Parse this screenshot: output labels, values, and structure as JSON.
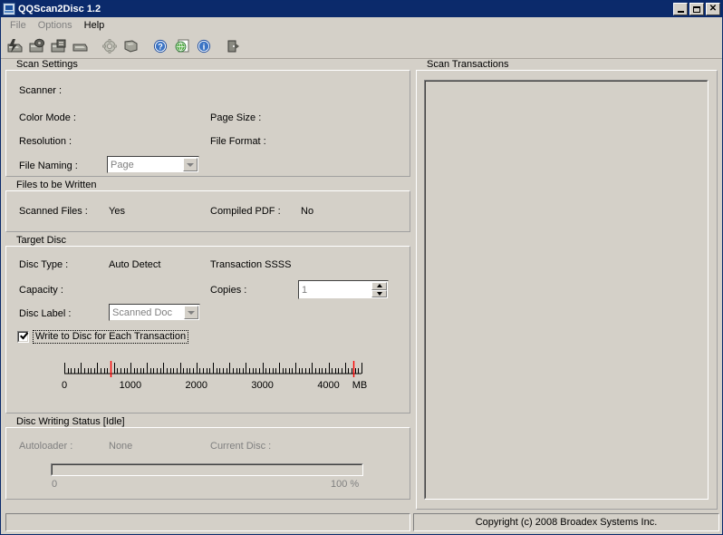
{
  "window": {
    "title": "QQScan2Disc 1.2",
    "icon": "scanner-icon",
    "buttons": {
      "minimize": "minimize-button",
      "maximize": "maximize-button",
      "close": "close-button"
    }
  },
  "menubar": {
    "items": [
      {
        "label": "File",
        "enabled": false
      },
      {
        "label": "Options",
        "enabled": false
      },
      {
        "label": "Help",
        "enabled": true
      }
    ]
  },
  "toolbar": {
    "buttons": [
      {
        "name": "scan-now-icon",
        "tooltip": "Scan"
      },
      {
        "name": "scan-to-disc-icon",
        "tooltip": "Scan to Disc"
      },
      {
        "name": "scan-to-file-icon",
        "tooltip": "Scan to File"
      },
      {
        "name": "disc-icon",
        "tooltip": "Disc"
      },
      {
        "name": "settings-gear-icon",
        "tooltip": "Settings"
      },
      {
        "name": "disc-write-icon",
        "tooltip": "Write Disc"
      },
      {
        "name": "help-question-icon",
        "tooltip": "Help"
      },
      {
        "name": "web-help-globe-icon",
        "tooltip": "Web Help"
      },
      {
        "name": "about-info-icon",
        "tooltip": "About"
      },
      {
        "name": "exit-door-icon",
        "tooltip": "Exit"
      }
    ]
  },
  "scan_settings": {
    "title": "Scan Settings",
    "scanner_label": "Scanner :",
    "scanner_value": "",
    "color_mode_label": "Color Mode :",
    "color_mode_value": "",
    "page_size_label": "Page Size :",
    "page_size_value": "",
    "resolution_label": "Resolution :",
    "resolution_value": "",
    "file_format_label": "File Format :",
    "file_format_value": "",
    "file_naming_label": "File Naming :",
    "file_naming_value": "Page"
  },
  "files_to_be_written": {
    "title": "Files to be Written",
    "scanned_files_label": "Scanned Files :",
    "scanned_files_value": "Yes",
    "compiled_pdf_label": "Compiled PDF :",
    "compiled_pdf_value": "No"
  },
  "target_disc": {
    "title": "Target Disc",
    "disc_type_label": "Disc Type :",
    "disc_type_value": "Auto Detect",
    "transaction_label": "Transaction SSSS",
    "capacity_label": "Capacity :",
    "capacity_value": "",
    "copies_label": "Copies :",
    "copies_value": "1",
    "disc_label_label": "Disc Label :",
    "disc_label_value": "Scanned Doc",
    "write_each_transaction_label": "Write to Disc for Each Transaction",
    "write_each_transaction_checked": true
  },
  "capacity_ruler": {
    "min": 0,
    "max": 4500,
    "tick_major_step": 250,
    "tick_minor_step": 50,
    "tick_labels": [
      {
        "value": 0,
        "text": "0"
      },
      {
        "value": 1000,
        "text": "1000"
      },
      {
        "value": 2000,
        "text": "2000"
      },
      {
        "value": 3000,
        "text": "3000"
      },
      {
        "value": 4000,
        "text": "4000"
      }
    ],
    "unit_label": "MB",
    "markers": [
      {
        "value": 700,
        "color": "#ff0000",
        "name": "cd-capacity-marker"
      },
      {
        "value": 4380,
        "color": "#ff0000",
        "name": "dvd-capacity-marker"
      }
    ]
  },
  "disc_writing_status": {
    "title": "Disc Writing Status  [Idle]",
    "state": "Idle",
    "autoloader_label": "Autoloader :",
    "autoloader_value": "None",
    "current_disc_label": "Current Disc :",
    "current_disc_value": "",
    "progress_percent": 0,
    "progress_min_label": "0",
    "progress_max_label": "100 %"
  },
  "scan_transactions": {
    "title": "Scan Transactions",
    "items": []
  },
  "statusbar": {
    "left_text": "",
    "right_text": "Copyright (c) 2008 Broadex Systems Inc."
  },
  "colors": {
    "face": "#d4d0c8",
    "titlebar": "#0b2a6b",
    "marker_red": "#ff0000",
    "disabled_text": "#808080"
  }
}
